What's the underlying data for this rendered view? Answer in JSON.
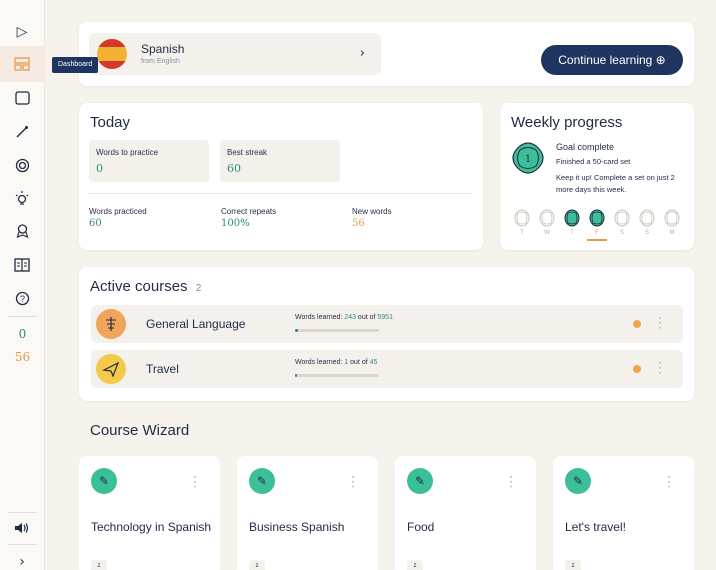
{
  "sidebar": {
    "toggle_icon": "expand-icon",
    "tooltip": "Dashboard",
    "items": [
      {
        "name": "dashboard-icon",
        "glyph": "▭"
      },
      {
        "name": "cards-icon",
        "glyph": "▢"
      },
      {
        "name": "wand-icon",
        "glyph": "⁄"
      },
      {
        "name": "target-icon",
        "glyph": "◎"
      },
      {
        "name": "bulb-icon",
        "glyph": "☼"
      },
      {
        "name": "award-icon",
        "glyph": "♁"
      },
      {
        "name": "book-icon",
        "glyph": "▤"
      },
      {
        "name": "help-icon",
        "glyph": "?"
      }
    ],
    "count_practice": "0",
    "count_streak": "56",
    "volume_icon": "speaker-icon",
    "expand_chevron": "›"
  },
  "language": {
    "name": "Spanish",
    "sub": "from English",
    "chevron": "›"
  },
  "continue_label": "Continue learning ⊕",
  "today": {
    "title": "Today",
    "words_to_practice_label": "Words to practice",
    "words_to_practice": "0",
    "best_streak_label": "Best streak",
    "best_streak": "60",
    "words_practiced_label": "Words practiced",
    "words_practiced": "60",
    "correct_repeats_label": "Correct repeats",
    "correct_repeats": "100%",
    "new_words_label": "New words",
    "new_words": "56"
  },
  "weekly": {
    "title": "Weekly progress",
    "goal_title": "Goal complete",
    "goal_sub": "Finished a 50-card set",
    "goal_msg": "Keep it up! Complete a set on just 2 more days this week.",
    "days": [
      {
        "label": "T",
        "done": false
      },
      {
        "label": "W",
        "done": false
      },
      {
        "label": "T",
        "done": true
      },
      {
        "label": "F",
        "done": true,
        "today": true
      },
      {
        "label": "S",
        "done": false
      },
      {
        "label": "S",
        "done": false
      },
      {
        "label": "M",
        "done": false
      }
    ]
  },
  "active_courses": {
    "title": "Active courses",
    "count": "2",
    "courses": [
      {
        "name": "General Language",
        "progress_prefix": "Words learned: ",
        "learned": "243",
        "mid": " out of ",
        "total": "5951",
        "progress": 0.04,
        "icon_color": "#f2a55a",
        "icon": "course-general-icon"
      },
      {
        "name": "Travel",
        "progress_prefix": "Words learned: ",
        "learned": "1",
        "mid": " out of ",
        "total": "45",
        "progress": 0.02,
        "icon_color": "#f5c94a",
        "icon": "plane-icon"
      }
    ]
  },
  "wizard": {
    "title": "Course Wizard",
    "cards": [
      {
        "title": "Technology in Spanish",
        "tag": "z"
      },
      {
        "title": "Business Spanish",
        "tag": "z"
      },
      {
        "title": "Food",
        "tag": "z"
      },
      {
        "title": "Let's travel!",
        "tag": "z"
      }
    ]
  },
  "colors": {
    "navy": "#1f3560",
    "teal": "#2e8a7a",
    "orange": "#f0a54b",
    "bg": "#f6f2ec"
  }
}
